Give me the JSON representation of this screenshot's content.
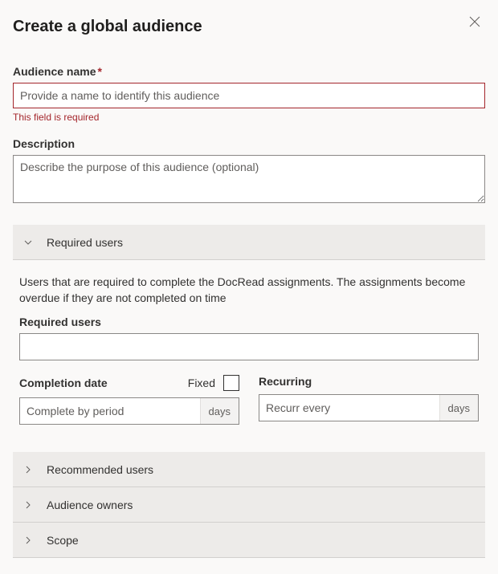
{
  "dialog": {
    "title": "Create a global audience"
  },
  "audienceName": {
    "label": "Audience name",
    "placeholder": "Provide a name to identify this audience",
    "error": "This field is required"
  },
  "description": {
    "label": "Description",
    "placeholder": "Describe the purpose of this audience (optional)"
  },
  "requiredUsersSection": {
    "title": "Required users",
    "helpText": "Users that are required to complete the DocRead assignments. The assignments become overdue if they are not completed on time",
    "usersLabel": "Required users",
    "completion": {
      "label": "Completion date",
      "fixedLabel": "Fixed",
      "placeholder": "Complete by period",
      "suffix": "days"
    },
    "recurring": {
      "label": "Recurring",
      "placeholder": "Recurr every",
      "suffix": "days"
    }
  },
  "collapsed": {
    "recommended": "Recommended users",
    "owners": "Audience owners",
    "scope": "Scope"
  }
}
